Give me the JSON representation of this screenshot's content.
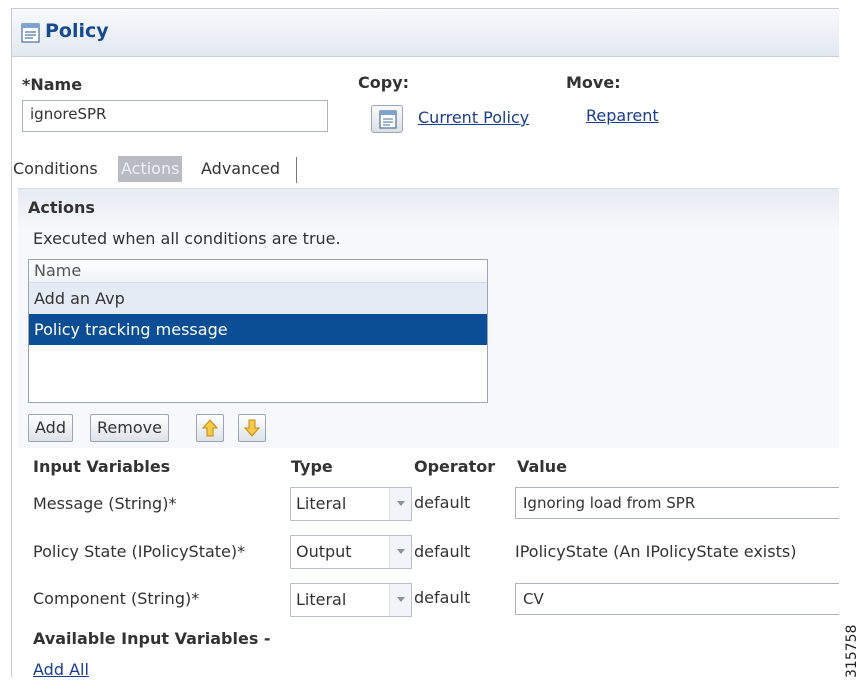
{
  "header": {
    "title": "Policy"
  },
  "name_field": {
    "label": "*Name",
    "value": "ignoreSPR"
  },
  "copy": {
    "label": "Copy:",
    "link": "Current Policy"
  },
  "move": {
    "label": "Move:",
    "link": "Reparent"
  },
  "tabs": [
    {
      "label": "Conditions"
    },
    {
      "label": "Actions",
      "active": true
    },
    {
      "label": "Advanced"
    }
  ],
  "actions": {
    "heading": "Actions",
    "description": "Executed when all conditions are true.",
    "list_header": "Name",
    "items": [
      "Add an Avp",
      "Policy tracking message"
    ],
    "selected_index": 1,
    "buttons": {
      "add": "Add",
      "remove": "Remove"
    }
  },
  "columns": {
    "input_variables": "Input Variables",
    "type": "Type",
    "operator": "Operator",
    "value": "Value"
  },
  "variables": [
    {
      "label": "Message (String)*",
      "type": "Literal",
      "operator": "default",
      "value": "Ignoring load from SPR"
    },
    {
      "label": "Policy State (IPolicyState)*",
      "type": "Output",
      "operator": "default",
      "value": "IPolicyState (An IPolicyState exists)"
    },
    {
      "label": "Component (String)*",
      "type": "Literal",
      "operator": "default",
      "value": "CV"
    }
  ],
  "available": {
    "heading": "Available Input Variables -",
    "add_all": "Add All"
  },
  "figure_id": "315758",
  "colors": {
    "title": "#174a8d",
    "selection": "#0b4e96",
    "link": "#1a3d8f"
  }
}
